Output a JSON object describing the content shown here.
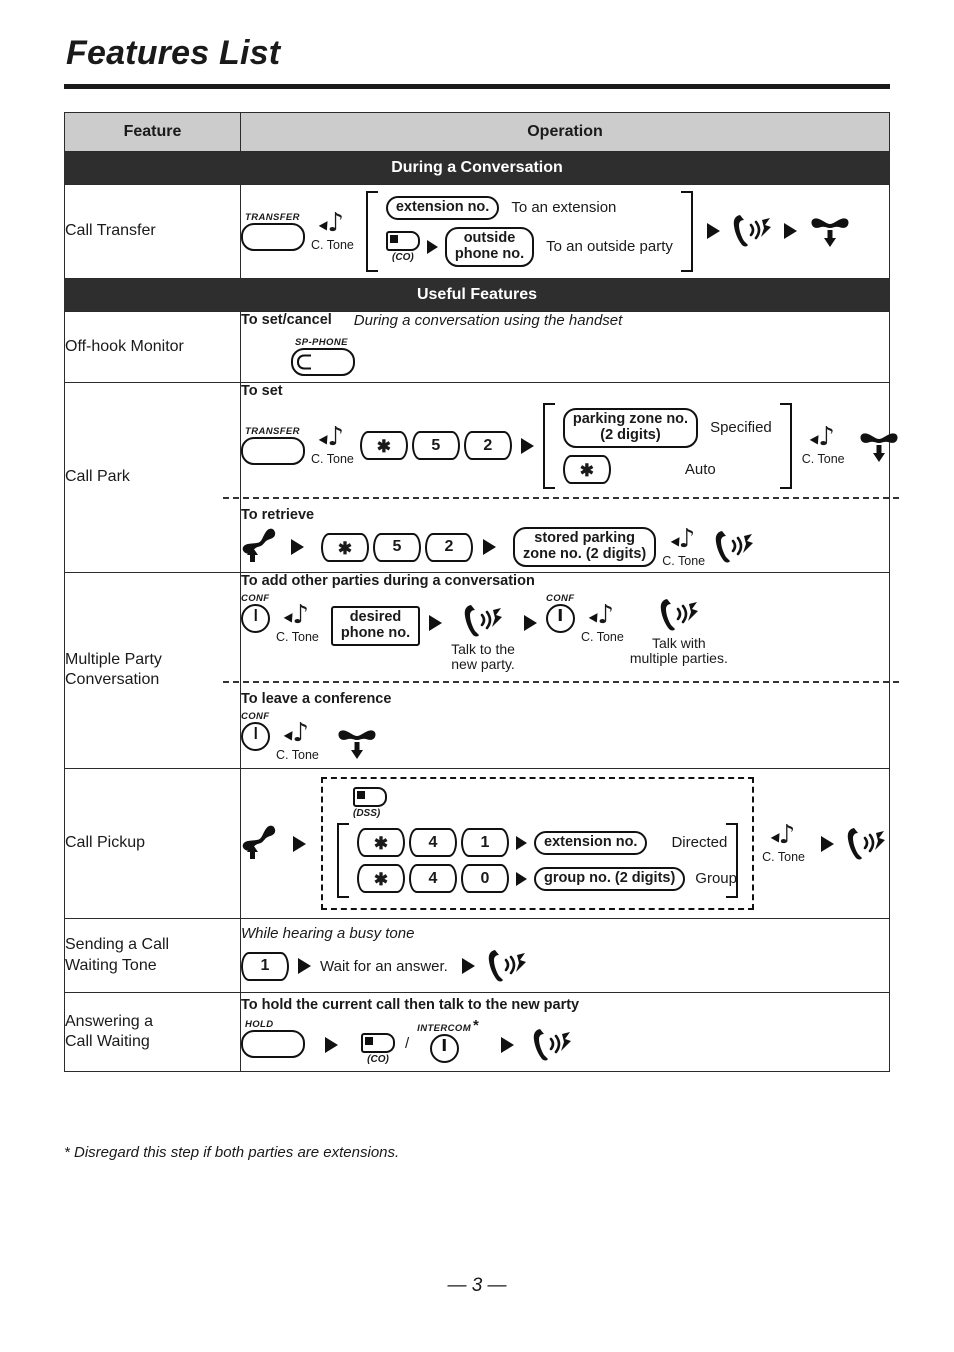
{
  "page": {
    "title": "Features List",
    "footnote": "* Disregard this step if both parties are extensions.",
    "page_number": "— 3 —"
  },
  "table": {
    "headers": {
      "feature": "Feature",
      "operation": "Operation"
    },
    "sections": {
      "during_conversation": "During a Conversation",
      "useful_features": "Useful Features"
    },
    "rows": {
      "call_transfer": {
        "feature": "Call Transfer",
        "transfer_button": "TRANSFER",
        "c_tone": "C. Tone",
        "extension_no": "extension no.",
        "to_an_extension": "To an extension",
        "co_button": "(CO)",
        "outside_phone_no_l1": "outside",
        "outside_phone_no_l2": "phone no.",
        "to_an_outside_party": "To an outside party"
      },
      "off_hook_monitor": {
        "feature": "Off-hook Monitor",
        "to_set_cancel": "To set/cancel",
        "condition": "During a conversation using the handset",
        "sp_phone_button": "SP-PHONE"
      },
      "call_park": {
        "feature": "Call Park",
        "to_set": "To set",
        "transfer_button": "TRANSFER",
        "c_tone": "C. Tone",
        "keys_set": [
          "✱",
          "5",
          "2"
        ],
        "parking_zone_l1": "parking zone no.",
        "parking_zone_l2": "(2 digits)",
        "specified": "Specified",
        "auto_key": "✱",
        "auto": "Auto",
        "c_tone_2": "C. Tone",
        "to_retrieve": "To retrieve",
        "keys_retrieve": [
          "✱",
          "5",
          "2"
        ],
        "stored_parking_l1": "stored parking",
        "stored_parking_l2": "zone no. (2 digits)",
        "c_tone_3": "C. Tone"
      },
      "multiple_party": {
        "feature_l1": "Multiple Party",
        "feature_l2": "Conversation",
        "to_add": "To add other parties during a conversation",
        "conf_button": "CONF",
        "c_tone": "C. Tone",
        "desired_phone_l1": "desired",
        "desired_phone_l2": "phone no.",
        "talk_new_l1": "Talk to the",
        "talk_new_l2": "new party.",
        "conf_button_2": "CONF",
        "c_tone_2": "C. Tone",
        "talk_multi_l1": "Talk with",
        "talk_multi_l2": "multiple parties.",
        "to_leave": "To leave a conference",
        "conf_button_3": "CONF",
        "c_tone_3": "C. Tone"
      },
      "call_pickup": {
        "feature": "Call Pickup",
        "dss_button": "(DSS)",
        "keys_directed": [
          "✱",
          "4",
          "1"
        ],
        "extension_no": "extension no.",
        "directed": "Directed",
        "keys_group": [
          "✱",
          "4",
          "0"
        ],
        "group_no": "group no. (2 digits)",
        "group": "Group",
        "c_tone": "C. Tone"
      },
      "sending_call_waiting": {
        "feature_l1": "Sending a Call",
        "feature_l2": "Waiting Tone",
        "condition": "While hearing a busy tone",
        "key": "1",
        "wait": "Wait for an answer."
      },
      "answering_call_waiting": {
        "feature_l1": "Answering a",
        "feature_l2": "Call Waiting",
        "instruction": "To hold the current call then talk to the new party",
        "hold_button": "HOLD",
        "co_button": "(CO)",
        "slash": "/",
        "intercom_button": "INTERCOM",
        "asterisk": "*"
      }
    }
  },
  "icons": {
    "talk": "talk-handset-icon",
    "hangup": "hang-up-handset-icon",
    "lift": "lift-handset-icon",
    "tone": "c-tone-note-icon",
    "arrow": "arrow-right-icon"
  },
  "colors": {
    "header_bg": "#cccccc",
    "section_bg": "#2e2e2e",
    "text": "#1a1a1a",
    "border": "#2b2b2b"
  }
}
